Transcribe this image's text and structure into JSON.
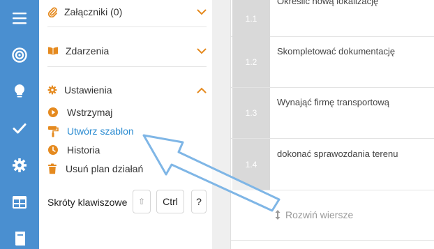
{
  "rail": {
    "icons": [
      "menu-icon",
      "target-icon",
      "lightbulb-icon",
      "check-icon",
      "gear-icon",
      "table-icon",
      "book-icon"
    ]
  },
  "panel": {
    "attachments": {
      "label": "Załączniki (0)"
    },
    "events": {
      "label": "Zdarzenia"
    },
    "settings": {
      "label": "Ustawienia",
      "items": [
        {
          "label": "Wstrzymaj",
          "icon": "play-icon"
        },
        {
          "label": "Utwórz szablon",
          "icon": "paint-roller-icon",
          "active": true
        },
        {
          "label": "Historia",
          "icon": "clock-icon"
        },
        {
          "label": "Usuń plan działań",
          "icon": "trash-icon"
        }
      ]
    },
    "shortcuts": {
      "label": "Skróty klawiszowe",
      "keys": [
        "⇧",
        "Ctrl",
        "?"
      ]
    }
  },
  "table": {
    "rows": [
      {
        "num": "1.1",
        "task": "Określić nową lokalizację"
      },
      {
        "num": "1.2",
        "task": "Skompletować dokumentację"
      },
      {
        "num": "1.3",
        "task": "Wynająć firmę transportową"
      },
      {
        "num": "1.4",
        "task": "dokonać sprawozdania terenu"
      }
    ],
    "expand_label": "Rozwiń wiersze"
  },
  "colors": {
    "rail": "#4a8fd0",
    "accent": "#e58a1f",
    "link": "#2a8bd1",
    "danger_icon": "#e58a1f"
  }
}
